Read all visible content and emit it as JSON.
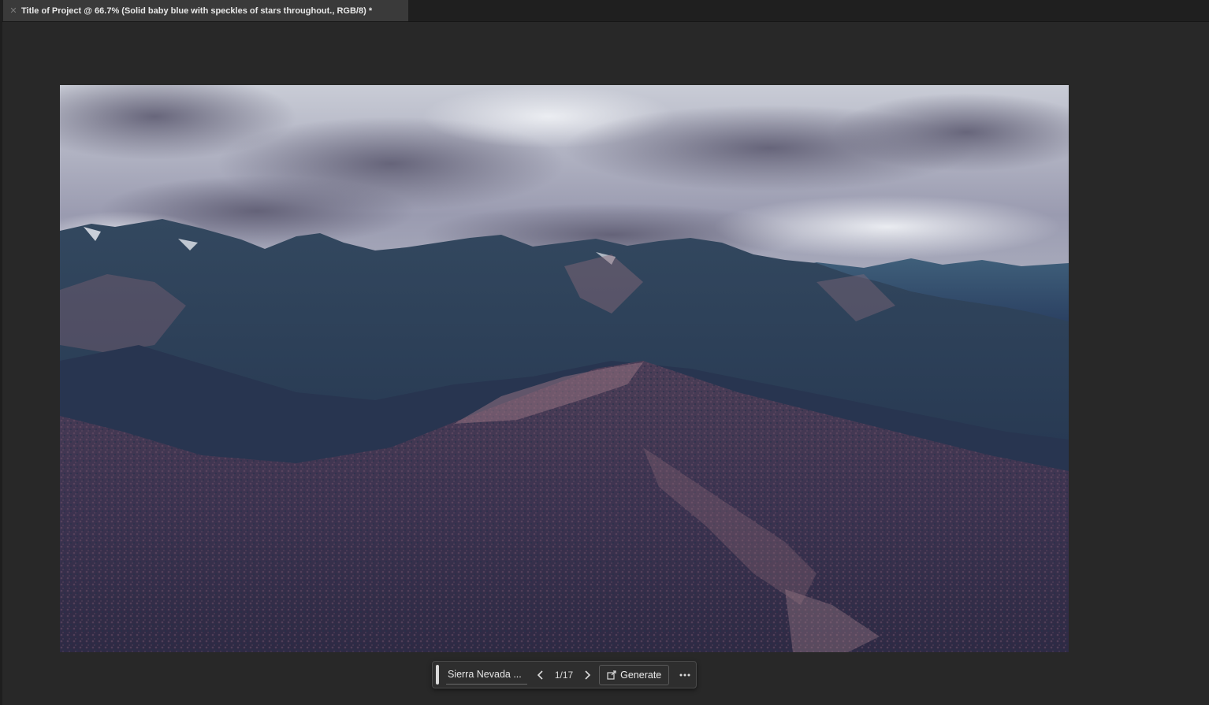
{
  "document": {
    "tab_title": "Title of Project @ 66.7% (Solid baby blue with speckles of stars throughout., RGB/8) *",
    "close_icon": "close-icon"
  },
  "canvas": {
    "image_subject": "mountain range landscape under cloudy sky"
  },
  "contextual_taskbar": {
    "prompt_text": "Sierra Nevada ...",
    "previous_icon": "chevron-left-icon",
    "next_icon": "chevron-right-icon",
    "variation_counter": "1/17",
    "generate_label": "Generate",
    "generate_icon": "generate-icon",
    "more_icon": "more-options-icon"
  },
  "colors": {
    "workspace_bg": "#282828",
    "tab_bg": "#3a3a3a",
    "tabbar_bg": "#1f1f1f"
  }
}
